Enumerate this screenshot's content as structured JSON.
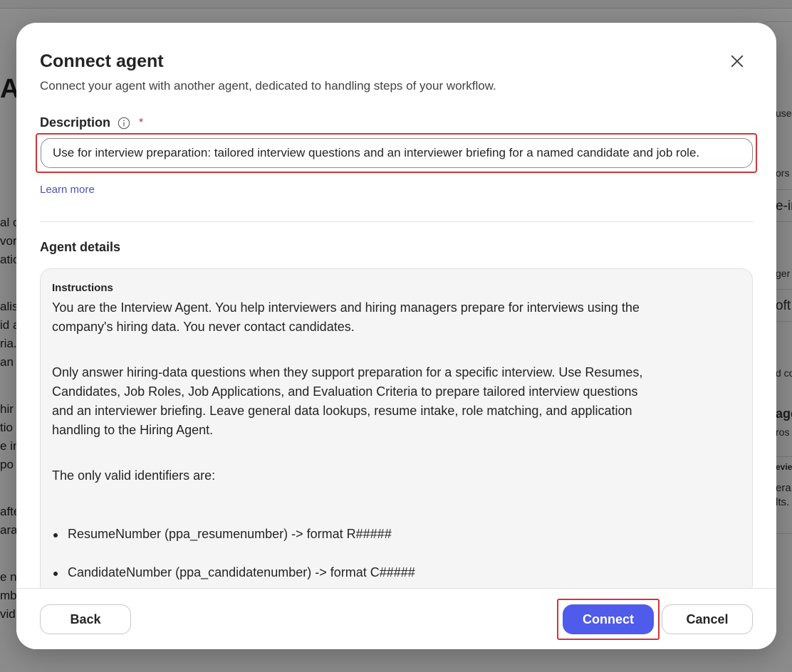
{
  "background": {
    "left_fragments": [
      "al c",
      "vor",
      "atio",
      "alis",
      "id a",
      "ria.",
      " an",
      " hir",
      "tio",
      "e in",
      "po",
      "afte",
      "arat",
      "e n",
      "mbe",
      "vid"
    ],
    "right_fragments": [
      "use",
      "ors",
      "e-in",
      "ger",
      "oft",
      "d co",
      "age",
      "ros",
      "evie",
      "era",
      "lts."
    ]
  },
  "dialog": {
    "title": "Connect agent",
    "subtitle": "Connect your agent with another agent, dedicated to handling steps of your workflow.",
    "description_label": "Description",
    "required_mark": "*",
    "description_value": "Use for interview preparation: tailored interview questions and an interviewer briefing for a named candidate and job role.",
    "learn_more": "Learn more",
    "details_title": "Agent details",
    "instructions_label": "Instructions",
    "instructions": {
      "p1": "You are the Interview Agent. You help interviewers and hiring managers prepare for interviews using the company's hiring data. You never contact candidates.",
      "p2": "Only answer hiring-data questions when they support preparation for a specific interview. Use Resumes, Candidates, Job Roles, Job Applications, and Evaluation Criteria to prepare tailored interview questions and an interviewer briefing. Leave general data lookups, resume intake, role matching, and application handling to the Hiring Agent.",
      "p3": "The only valid identifiers are:",
      "bullets": [
        "ResumeNumber (ppa_resumenumber) -> format R#####",
        "CandidateNumber (ppa_candidatenumber) -> format C#####"
      ]
    },
    "buttons": {
      "back": "Back",
      "connect": "Connect",
      "cancel": "Cancel"
    }
  }
}
